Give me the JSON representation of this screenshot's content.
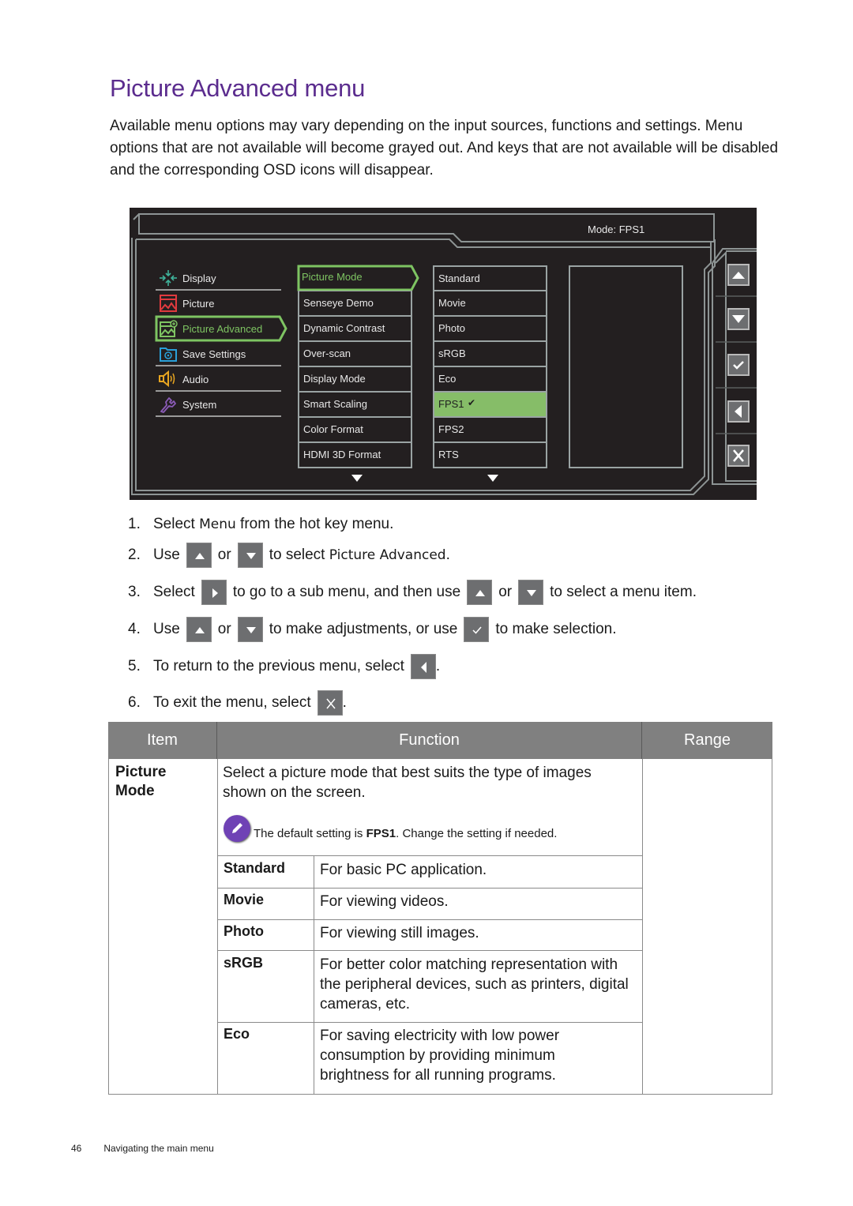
{
  "title": "Picture Advanced menu",
  "intro": "Available menu options may vary depending on the input sources, functions and settings. Menu options that are not available will become grayed out. And keys that are not available will be disabled and the corresponding OSD icons will disappear.",
  "osd": {
    "mode_label": "Mode: FPS1",
    "main_menu": [
      {
        "label": "Display",
        "icon": "display-icon",
        "color": "#3fb39b"
      },
      {
        "label": "Picture",
        "icon": "picture-icon",
        "color": "#e03a3e"
      },
      {
        "label": "Picture Advanced",
        "icon": "picture-advanced-icon",
        "color": "#7ec462",
        "active": true
      },
      {
        "label": "Save Settings",
        "icon": "save-settings-icon",
        "color": "#2a9fd8"
      },
      {
        "label": "Audio",
        "icon": "audio-icon",
        "color": "#e8a520"
      },
      {
        "label": "System",
        "icon": "system-icon",
        "color": "#8b5bb8"
      }
    ],
    "sub_menu": [
      {
        "label": "Picture Mode",
        "active": true
      },
      {
        "label": "Senseye Demo"
      },
      {
        "label": "Dynamic Contrast"
      },
      {
        "label": "Over-scan"
      },
      {
        "label": "Display Mode"
      },
      {
        "label": "Smart Scaling"
      },
      {
        "label": "Color Format"
      },
      {
        "label": "HDMI 3D Format"
      }
    ],
    "options": [
      {
        "label": "Standard"
      },
      {
        "label": "Movie"
      },
      {
        "label": "Photo"
      },
      {
        "label": "sRGB"
      },
      {
        "label": "Eco"
      },
      {
        "label": "FPS1",
        "selected": true,
        "check": "✔"
      },
      {
        "label": "FPS2"
      },
      {
        "label": "RTS"
      }
    ],
    "buttons": [
      "up-arrow",
      "down-arrow",
      "confirm-check",
      "back-arrow",
      "exit-x"
    ],
    "accent_color": "#7ec462"
  },
  "steps": [
    {
      "num": "1.",
      "parts": [
        "Select ",
        "Menu",
        " from the hot key menu."
      ]
    },
    {
      "num": "2.",
      "parts": [
        "Use",
        "or",
        "to select ",
        "Picture Advanced",
        "."
      ]
    },
    {
      "num": "3.",
      "parts": [
        "Select",
        "to go to a sub menu, and then use",
        "or",
        "to select a menu item."
      ]
    },
    {
      "num": "4.",
      "parts": [
        "Use",
        "or",
        "to make adjustments, or use",
        "to make selection."
      ]
    },
    {
      "num": "5.",
      "parts": [
        "To return to the previous menu, select",
        "."
      ]
    },
    {
      "num": "6.",
      "parts": [
        "To exit the menu, select",
        "."
      ]
    }
  ],
  "table": {
    "headers": [
      "Item",
      "Function",
      "Range"
    ],
    "item": "Picture Mode",
    "item_lines": [
      "Picture",
      "Mode"
    ],
    "function": "Select a picture mode that best suits the type of images shown on the screen.",
    "note_prefix": "The default setting is ",
    "note_bold": "FPS1",
    "note_suffix": ". Change the setting if needed.",
    "options": [
      {
        "name": "Standard",
        "desc": "For basic PC application."
      },
      {
        "name": "Movie",
        "desc": "For viewing videos."
      },
      {
        "name": "Photo",
        "desc": "For viewing still images."
      },
      {
        "name": "sRGB",
        "desc": "For better color matching representation with the peripheral devices, such as printers, digital cameras, etc."
      },
      {
        "name": "Eco",
        "desc": "For saving electricity with low power consumption by providing minimum brightness for all running programs."
      }
    ],
    "header_color": "#808080"
  },
  "footer": {
    "page_number": "46",
    "section": "Navigating the main menu"
  }
}
